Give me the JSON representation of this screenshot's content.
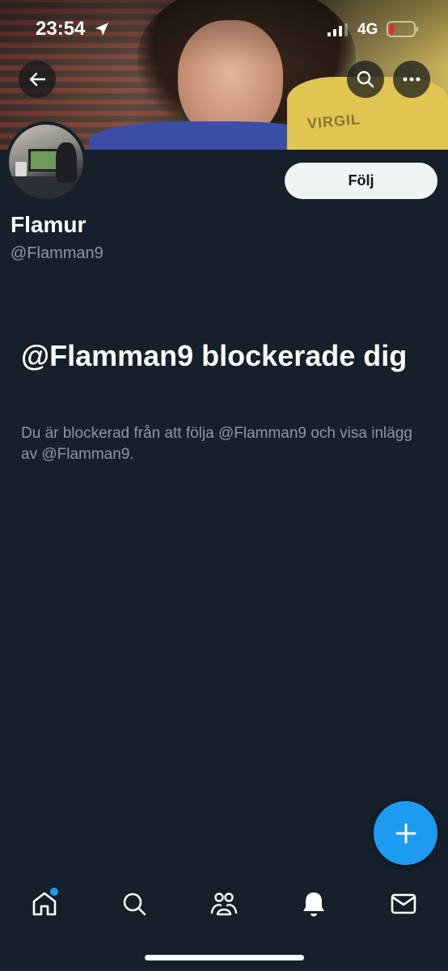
{
  "status_bar": {
    "time": "23:54",
    "network": "4G",
    "icons": [
      "location-arrow-icon",
      "signal-icon",
      "battery-low-icon"
    ]
  },
  "header": {
    "icons": [
      "back-arrow-icon",
      "search-icon",
      "more-dots-icon"
    ]
  },
  "profile": {
    "display_name": "Flamur",
    "handle": "@Flamman9",
    "follow_label": "Följ"
  },
  "blocked": {
    "title": "@Flamman9 blockerade dig",
    "description": "Du är blockerad från att följa @Flamman9 och visa inlägg av @Flamman9."
  },
  "fab": {
    "icon": "plus-icon"
  },
  "bottom_nav": {
    "items": [
      {
        "icon": "home-icon",
        "unread": true
      },
      {
        "icon": "search-icon",
        "unread": false
      },
      {
        "icon": "communities-icon",
        "unread": false
      },
      {
        "icon": "notifications-bell-icon",
        "unread": false
      },
      {
        "icon": "messages-envelope-icon",
        "unread": false
      }
    ]
  },
  "colors": {
    "background": "#15202b",
    "accent": "#1d9bf0",
    "secondary_text": "#8b98a5",
    "battery_low": "#f4212e"
  }
}
